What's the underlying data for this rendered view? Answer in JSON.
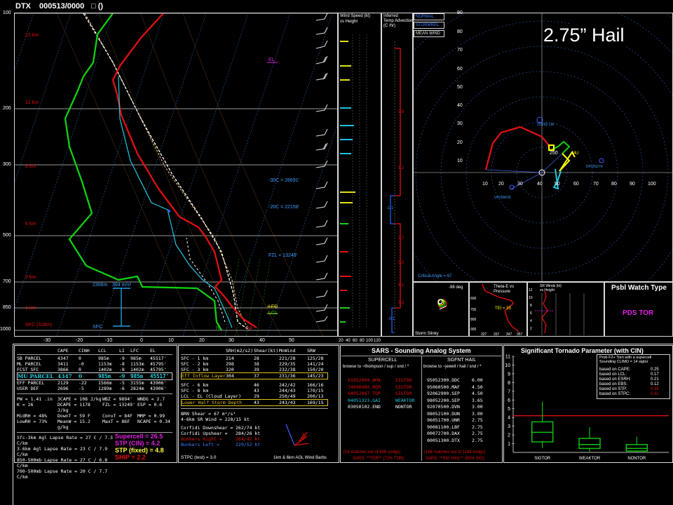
{
  "header": {
    "station": "DTX",
    "valid": "000513/0000",
    "extra": "□ ()"
  },
  "hail_label": "2.75” Hail",
  "colors": {
    "temp": "#e01010",
    "dew": "#10d010",
    "wetbulb": "#20c8e0",
    "parcel": "#ffffff",
    "virtual": "#ffd080",
    "box": "#d8d8d8",
    "accent_yellow": "#ffff00",
    "magenta": "#e020e0"
  },
  "skewt": {
    "pressure_labels": [
      "100",
      "200",
      "300",
      "500",
      "700",
      "850",
      "1000"
    ],
    "height_labels": [
      "15 km",
      "12 km",
      "9 km",
      "6 km",
      "3 km",
      "1 km",
      "SFC (328m)"
    ],
    "temp_ticks": [
      "-30",
      "-20",
      "-10",
      "0",
      "10",
      "20",
      "30",
      "40",
      "50"
    ],
    "annotations": {
      "el": "EL",
      "m30c": "-30C = 26691'",
      "m20c": "-20C = 22158'",
      "fzl": "FZL = 13249'",
      "lfc": "LFC",
      "lcl": "LCL",
      "dcape": "2306m",
      "dcape2": "304 m/s²",
      "sfc": "SFC",
      "t70": "70",
      "t84": "84"
    }
  },
  "wind_profile": {
    "title1": "Wind Speed (kt)",
    "title2": "vs Height",
    "ticks": [
      "20",
      "40",
      "60",
      "80",
      "100",
      "120"
    ]
  },
  "temp_adv": {
    "title1": "Inferred",
    "title2": "Temp Advection",
    "title3": "(C /hr)",
    "values": [
      "0.6",
      "1.2",
      "-1.1",
      "3.7",
      "0.0",
      "4.1",
      "5.3",
      "-0.1"
    ]
  },
  "hodograph": {
    "legend": [
      "NORMAL",
      "STORMREL",
      "MEAN WIND"
    ],
    "x_ticks": [
      "10",
      "20",
      "30",
      "40",
      "50",
      "60",
      "70",
      "80",
      "90",
      "100"
    ],
    "y_ticks": [
      "90",
      "80",
      "70",
      "60",
      "50",
      "40",
      "30",
      "20",
      "10"
    ],
    "rm_label": "229/52 LM",
    "lm_label": "UP/284/26",
    "dp_label": "DP/262/74",
    "mu_label": "MU",
    "n250": "250",
    "critical_angle": "Critical Angle = 67"
  },
  "storm_slinky": {
    "title": "Storm Slinky",
    "deg": "-98 deg"
  },
  "theta_e": {
    "title1": "Theta-E vs",
    "title2": "Pressure",
    "tei": "TEI = 33",
    "p_ticks": [
      "600",
      "700",
      "800",
      "900"
    ],
    "x_ticks": [
      "327",
      "337",
      "347",
      "357"
    ]
  },
  "sr_winds": {
    "title1": "SR Winds (kt)",
    "title2": "vs Height",
    "ticks": [
      "12",
      "10",
      "8",
      "6",
      "4",
      "2"
    ]
  },
  "watch": {
    "title": "Psbl Watch Type",
    "value": "PDS TOR"
  },
  "parcels": {
    "headers": [
      "CAPE",
      "CINH",
      "LCL",
      "LI",
      "LFC",
      "EL"
    ],
    "rows": [
      {
        "name": "SB PARCEL",
        "vals": [
          "4347",
          "0",
          "985m",
          "-9",
          "985m",
          "45517'"
        ]
      },
      {
        "name": "ML PARCEL",
        "vals": [
          "3411",
          "-0",
          "1153m",
          "-8",
          "1153m",
          "45795'"
        ]
      },
      {
        "name": "FCST SFC",
        "vals": [
          "3866",
          "0",
          "1402m",
          "-8",
          "1402m",
          "45795'"
        ]
      },
      {
        "name": "MU PARCEL",
        "vals": [
          "4347",
          "0",
          "985m",
          "-9",
          "985m",
          "45517'"
        ]
      },
      {
        "name": "EFF PARCEL",
        "vals": [
          "2129",
          "-22",
          "1566m",
          "-5",
          "3155m",
          "43906'"
        ]
      },
      {
        "name": "USER DEF",
        "vals": [
          "2696",
          "-5",
          "1289m",
          "-6",
          "2824m",
          "43906'"
        ]
      }
    ],
    "indices": [
      [
        "PW = 1.41 .in",
        "3CAPE = 108 J/kg",
        "WBZ = 9894'",
        "WNDG = 2.7"
      ],
      [
        "K = 26",
        "DCAPE = 1178 J/kg",
        "FZL = 13249'",
        "ESP = 0.6"
      ],
      [
        "MidRH = 48%",
        "DownT = 59 F",
        "ConvT = 84F",
        "MMP = 0.99"
      ],
      [
        "LowRH = 73%",
        "MeanW = 15.2 g/kg",
        "MaxT = 86F",
        "NCAPE = 0.34"
      ]
    ],
    "lapse": [
      "Sfc-3km Agl Lapse Rate = 27 C / 7.3 C/km",
      "3-6km Agl Lapse Rate = 23 C / 7.9 C/km",
      "850-500mb Lapse Rate = 27 C / 6.8 C/km",
      "700-500mb Lapse Rate = 20 C / 7.7 C/km"
    ],
    "composite": [
      "Supercell = 26.5",
      "STP (CIN) = 4.2",
      "STP (fixed) = 4.8",
      "SHIP = 2.2"
    ]
  },
  "kinematics": {
    "headers": [
      "SRH(m2/s2)",
      "Shear(kt)",
      "MnWind",
      "SRW"
    ],
    "rows1": [
      {
        "name": "SFC - 1 km",
        "vals": [
          "214",
          "28",
          "221/28",
          "125/28"
        ]
      },
      {
        "name": "SFC - 2 km",
        "vals": [
          "298",
          "38",
          "229/35",
          "141/24"
        ]
      },
      {
        "name": "SFC - 3 km",
        "vals": [
          "320",
          "39",
          "232/38",
          "150/20"
        ]
      },
      {
        "name": "Eff Inflow Layer",
        "vals": [
          "304",
          "37",
          "231/36",
          "145/23"
        ]
      }
    ],
    "rows2": [
      {
        "name": "SFC - 6 km",
        "vals": [
          "",
          "46",
          "242/42",
          "166/16"
        ]
      },
      {
        "name": "SFC - 8 km",
        "vals": [
          "",
          "43",
          "244/43",
          "170/15"
        ]
      },
      {
        "name": "LCL - EL (Cloud Layer)",
        "vals": [
          "",
          "29",
          "250/49",
          "200/13"
        ]
      },
      {
        "name": "Lower Half Storm Depth",
        "vals": [
          "",
          "43",
          "243/43",
          "169/15"
        ]
      }
    ],
    "brn": [
      "BRN Shear = 67 m²/s²",
      "4-6km SR Wind = 228/15 kt"
    ],
    "corfidi": [
      {
        "name": "Corfidi Downshear =",
        "val": "262/74 kt"
      },
      {
        "name": "Corfidi Upshear =",
        "val": "284/26 kt"
      },
      {
        "name": "Bunkers Right =",
        "val": "264/42 kt"
      },
      {
        "name": "Bunkers Left =",
        "val": "229/52 kt"
      }
    ],
    "stpc": "STPC (test) = 3.0",
    "barbs": "1km & 6km AGL Wind Barbs"
  },
  "sars": {
    "title": "SARS - Sounding Analog System",
    "col1_title": "SUPERCELL",
    "col1_sub": "browse to ~thompson / sup / snd / *",
    "col2_title": "SGFNT HAIL",
    "col2_sub": "browse to ~jewell / hail / snd / *",
    "col1": [
      {
        "id": "01052000.AMA",
        "type": "SIGTOR"
      },
      {
        "id": "74040400.MGM",
        "type": "SIGTOR"
      },
      {
        "id": "04052007.TOP",
        "type": "SIGTOR"
      },
      {
        "id": "04051323.GAI",
        "type": "WEAKTOR"
      },
      {
        "id": "03050102.END",
        "type": "NONTOR"
      }
    ],
    "col2": [
      {
        "id": "95052300.DDC",
        "val": "6.00"
      },
      {
        "id": "95060500.MAF",
        "val": "4.50"
      },
      {
        "id": "92062900.SEP",
        "val": "4.50"
      },
      {
        "id": "98052200.SEP",
        "val": "3.65"
      },
      {
        "id": "92070500.DVN",
        "val": "3.00"
      },
      {
        "id": "98052100.DUN",
        "val": "3.00"
      },
      {
        "id": "96051700.UNR",
        "val": "2.75"
      },
      {
        "id": "90081100.LBF",
        "val": "2.75"
      },
      {
        "id": "00072700.DAX",
        "val": "2.75"
      },
      {
        "id": "00051300.DTX",
        "val": "2.75"
      }
    ],
    "foot1a": "(18 matches out of 856 sndgs)",
    "foot1b": "SARS: **TOR**  (72% TOR)",
    "foot2a": "(166 matches out of 1148 sndgs)",
    "foot2b": "SARS: **SIG HAIL**  (85% SIG)"
  },
  "stp": {
    "title": "Significant Tornado Parameter (with CIN)",
    "legend_title": [
      "Prob F2+ Torn with a supercell",
      "Sounding CLIMO = 14 sigtor"
    ],
    "legend_rows": [
      {
        "name": "based on CAPE:",
        "val": "0.25"
      },
      {
        "name": "based on LCL:",
        "val": "0.17"
      },
      {
        "name": "based on ESRH:",
        "val": "0.21"
      },
      {
        "name": "based on EBS:",
        "val": "0.12"
      },
      {
        "name": "based on STP:",
        "val": "0.39"
      },
      {
        "name": "based on STPC:",
        "val": "0.41"
      }
    ]
  },
  "chart_data": {
    "type": "box",
    "title": "Significant Tornado Parameter (with CIN)",
    "categories": [
      "SIGTOR",
      "WEAKTOR",
      "NONTOR"
    ],
    "y_ticks": [
      "1",
      "2",
      "3",
      "4",
      "5",
      "6",
      "7",
      "8",
      "9",
      "10",
      "11"
    ],
    "ylim": [
      0,
      11
    ],
    "boxes": [
      {
        "name": "SIGTOR",
        "whisker_low": 0.5,
        "q1": 1.2,
        "median": 2.3,
        "q3": 3.5,
        "whisker_high": 5.8
      },
      {
        "name": "WEAKTOR",
        "whisker_low": 0.1,
        "q1": 0.45,
        "median": 0.9,
        "q3": 1.6,
        "whisker_high": 2.9
      },
      {
        "name": "NONTOR",
        "whisker_low": 0.0,
        "q1": 0.15,
        "median": 0.45,
        "q3": 0.9,
        "whisker_high": 1.8
      }
    ],
    "sounding_value": 4.2
  }
}
